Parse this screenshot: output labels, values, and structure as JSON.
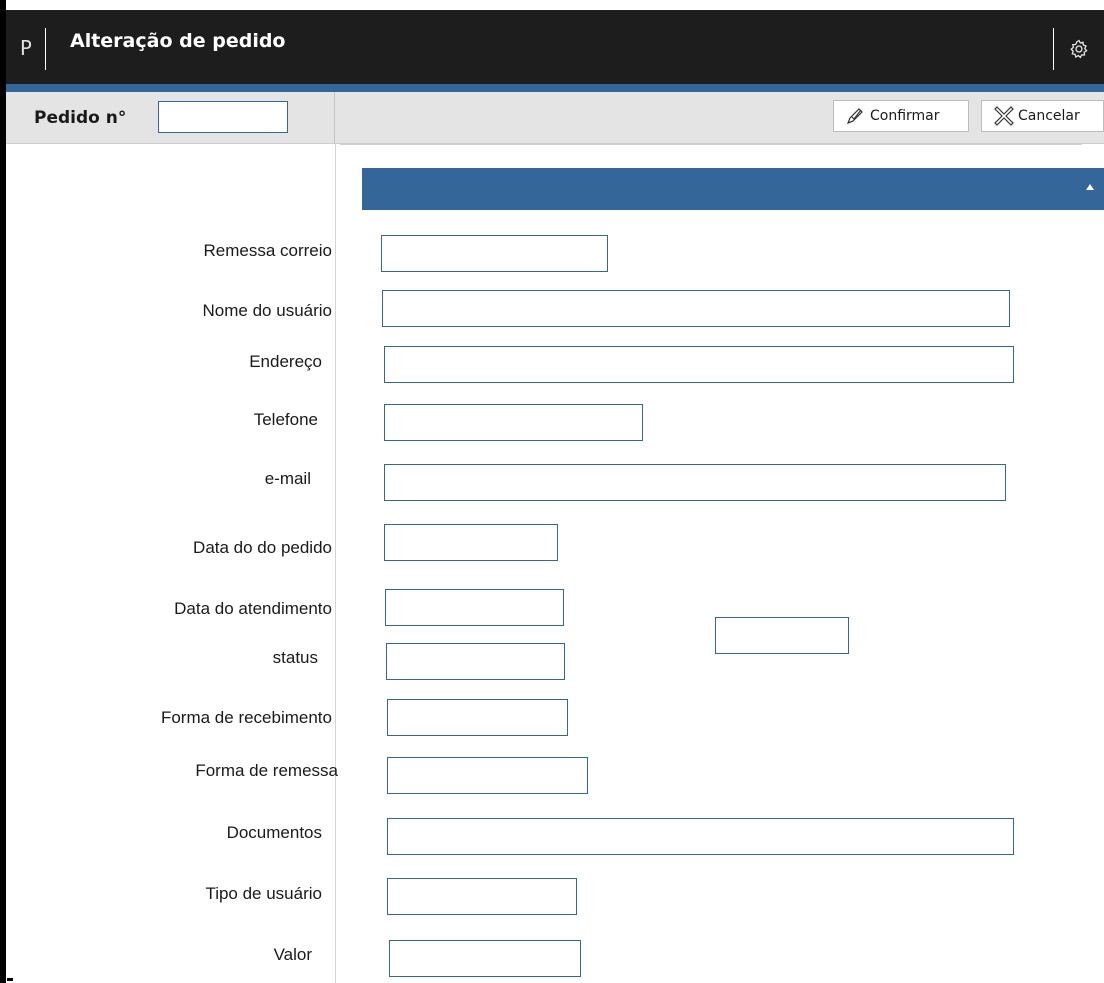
{
  "titlebar": {
    "app_letter": "P",
    "title": "Alteração de pedido",
    "settings_icon": "gear-icon"
  },
  "toolbar": {
    "pedido_label": "Pedido n°",
    "pedido_value": "",
    "confirm_label": "Confirmar",
    "confirm_icon": "check-icon",
    "cancel_label": "Cancelar",
    "cancel_icon": "cancel-icon"
  },
  "section": {
    "collapse_icon": "collapse-arrow-icon"
  },
  "form": {
    "fields": [
      {
        "label": "Remessa correio",
        "value": ""
      },
      {
        "label": "Nome do usuário",
        "value": ""
      },
      {
        "label": "Endereço",
        "value": ""
      },
      {
        "label": "Telefone",
        "value": ""
      },
      {
        "label": "e-mail",
        "value": ""
      },
      {
        "label": "Data do do pedido",
        "value": ""
      },
      {
        "label": "Data do atendimento",
        "value": ""
      },
      {
        "label": "status",
        "value": ""
      },
      {
        "label": "Forma de recebimento",
        "value": ""
      },
      {
        "label": "Forma de remessa",
        "value": ""
      },
      {
        "label": "Documentos",
        "value": ""
      },
      {
        "label": "Tipo de usuário",
        "value": ""
      },
      {
        "label": "Valor",
        "value": ""
      }
    ],
    "extra_field_value": ""
  },
  "colors": {
    "accent": "#356699",
    "titlebar": "#1d1d1d",
    "toolbar": "#e4e4e4"
  }
}
